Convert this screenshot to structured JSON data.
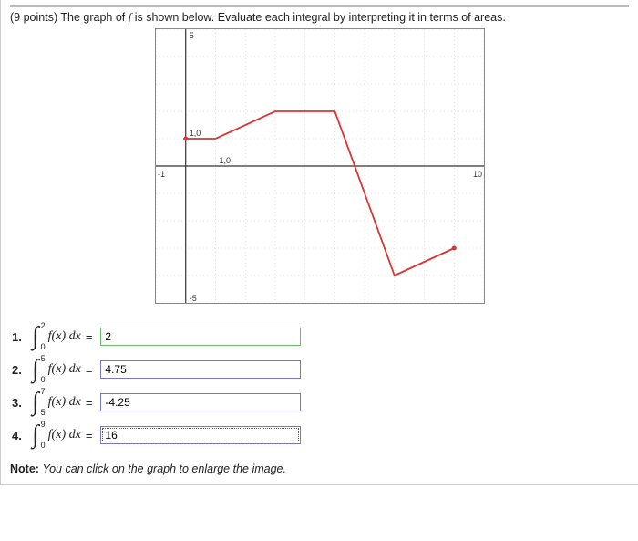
{
  "prompt": {
    "points_prefix": "(9 points) ",
    "text_before_f": "The graph of ",
    "f_symbol": "f",
    "text_after_f": " is shown below. Evaluate each integral by interpreting it in terms of areas."
  },
  "chart_data": {
    "type": "line",
    "title": "",
    "xlabel": "",
    "ylabel": "",
    "xlim": [
      -1,
      10
    ],
    "ylim": [
      -5,
      5
    ],
    "x_ticks": [
      -1,
      10
    ],
    "y_ticks": [
      -5,
      5
    ],
    "point_labels": [
      {
        "at_x": 0,
        "at_y": 1,
        "label": "1,0"
      },
      {
        "at_x": 1,
        "at_y": 0,
        "label": "1,0"
      }
    ],
    "series": [
      {
        "name": "f(x)",
        "color": "#d33",
        "x": [
          0,
          1,
          3,
          5,
          7,
          9
        ],
        "values": [
          1,
          1,
          2,
          2,
          -4,
          -3
        ]
      }
    ]
  },
  "integrand_text": "f(x) dx",
  "equals_text": "=",
  "questions": [
    {
      "num": "1.",
      "lower": "0",
      "upper": "2",
      "value": "2",
      "state": "green"
    },
    {
      "num": "2.",
      "lower": "0",
      "upper": "5",
      "value": "4.75",
      "state": "blue"
    },
    {
      "num": "3.",
      "lower": "5",
      "upper": "7",
      "value": "-4.25",
      "state": "blue"
    },
    {
      "num": "4.",
      "lower": "0",
      "upper": "9",
      "value": "16",
      "state": "active"
    }
  ],
  "note": {
    "bold": "Note:",
    "italic": " You can click on the graph to enlarge the image."
  }
}
